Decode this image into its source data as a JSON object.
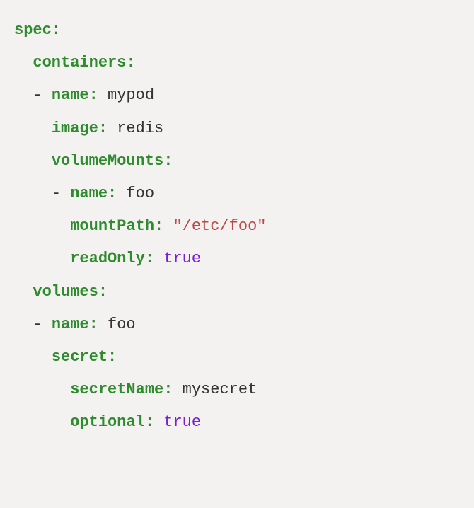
{
  "yaml": {
    "spec_key": "spec",
    "containers_key": "containers",
    "dash": "-",
    "name_key": "name",
    "container_name": "mypod",
    "image_key": "image",
    "image_val": "redis",
    "volumeMounts_key": "volumeMounts",
    "vm_name_key": "name",
    "vm_name_val": "foo",
    "mountPath_key": "mountPath",
    "mountPath_val": "\"/etc/foo\"",
    "readOnly_key": "readOnly",
    "readOnly_val": "true",
    "volumes_key": "volumes",
    "vol_name_key": "name",
    "vol_name_val": "foo",
    "secret_key": "secret",
    "secretName_key": "secretName",
    "secretName_val": "mysecret",
    "optional_key": "optional",
    "optional_val": "true",
    "colon": ":",
    "space": " "
  }
}
